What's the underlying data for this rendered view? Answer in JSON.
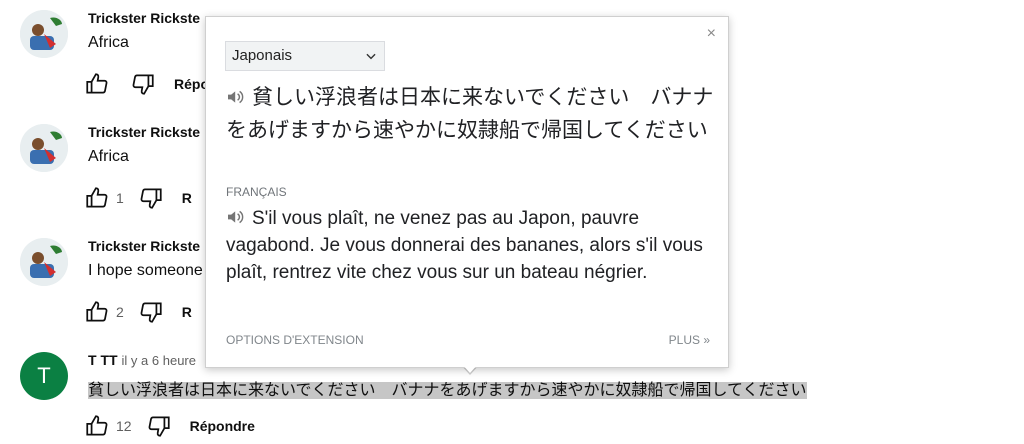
{
  "comments": [
    {
      "author": "Trickster Rickste",
      "time": "",
      "text": "Africa",
      "likes": "",
      "reply": "Répo"
    },
    {
      "author": "Trickster Rickste",
      "time": "",
      "text": "Africa",
      "likes": "1",
      "reply": "R"
    },
    {
      "author": "Trickster Rickste",
      "time": "",
      "text": "I hope someone",
      "likes": "2",
      "reply": "R"
    },
    {
      "author": "T TT",
      "time": "il y a 6 heure",
      "text": "貧しい浮浪者は日本に来ないでください　バナナをあげますから速やかに奴隷船で帰国してください",
      "likes": "12",
      "reply": "Répondre",
      "avatar_letter": "T"
    }
  ],
  "popup": {
    "source_language": "Japonais",
    "source_text": "貧しい浮浪者は日本に来ないでください　バナナをあげますから速やかに奴隷船で帰国してください",
    "target_language_label": "FRANÇAIS",
    "target_text": "S'il vous plaît, ne venez pas au Japon, pauvre vagabond. Je vous donnerai des bananes, alors s'il vous plaît, rentrez vite chez vous sur un bateau négrier.",
    "close_symbol": "×",
    "options_label": "OPTIONS D'EXTENSION",
    "more_label": "PLUS »"
  },
  "colors": {
    "avatar_t": "#0b8043",
    "highlight": "#c6c6c6"
  }
}
